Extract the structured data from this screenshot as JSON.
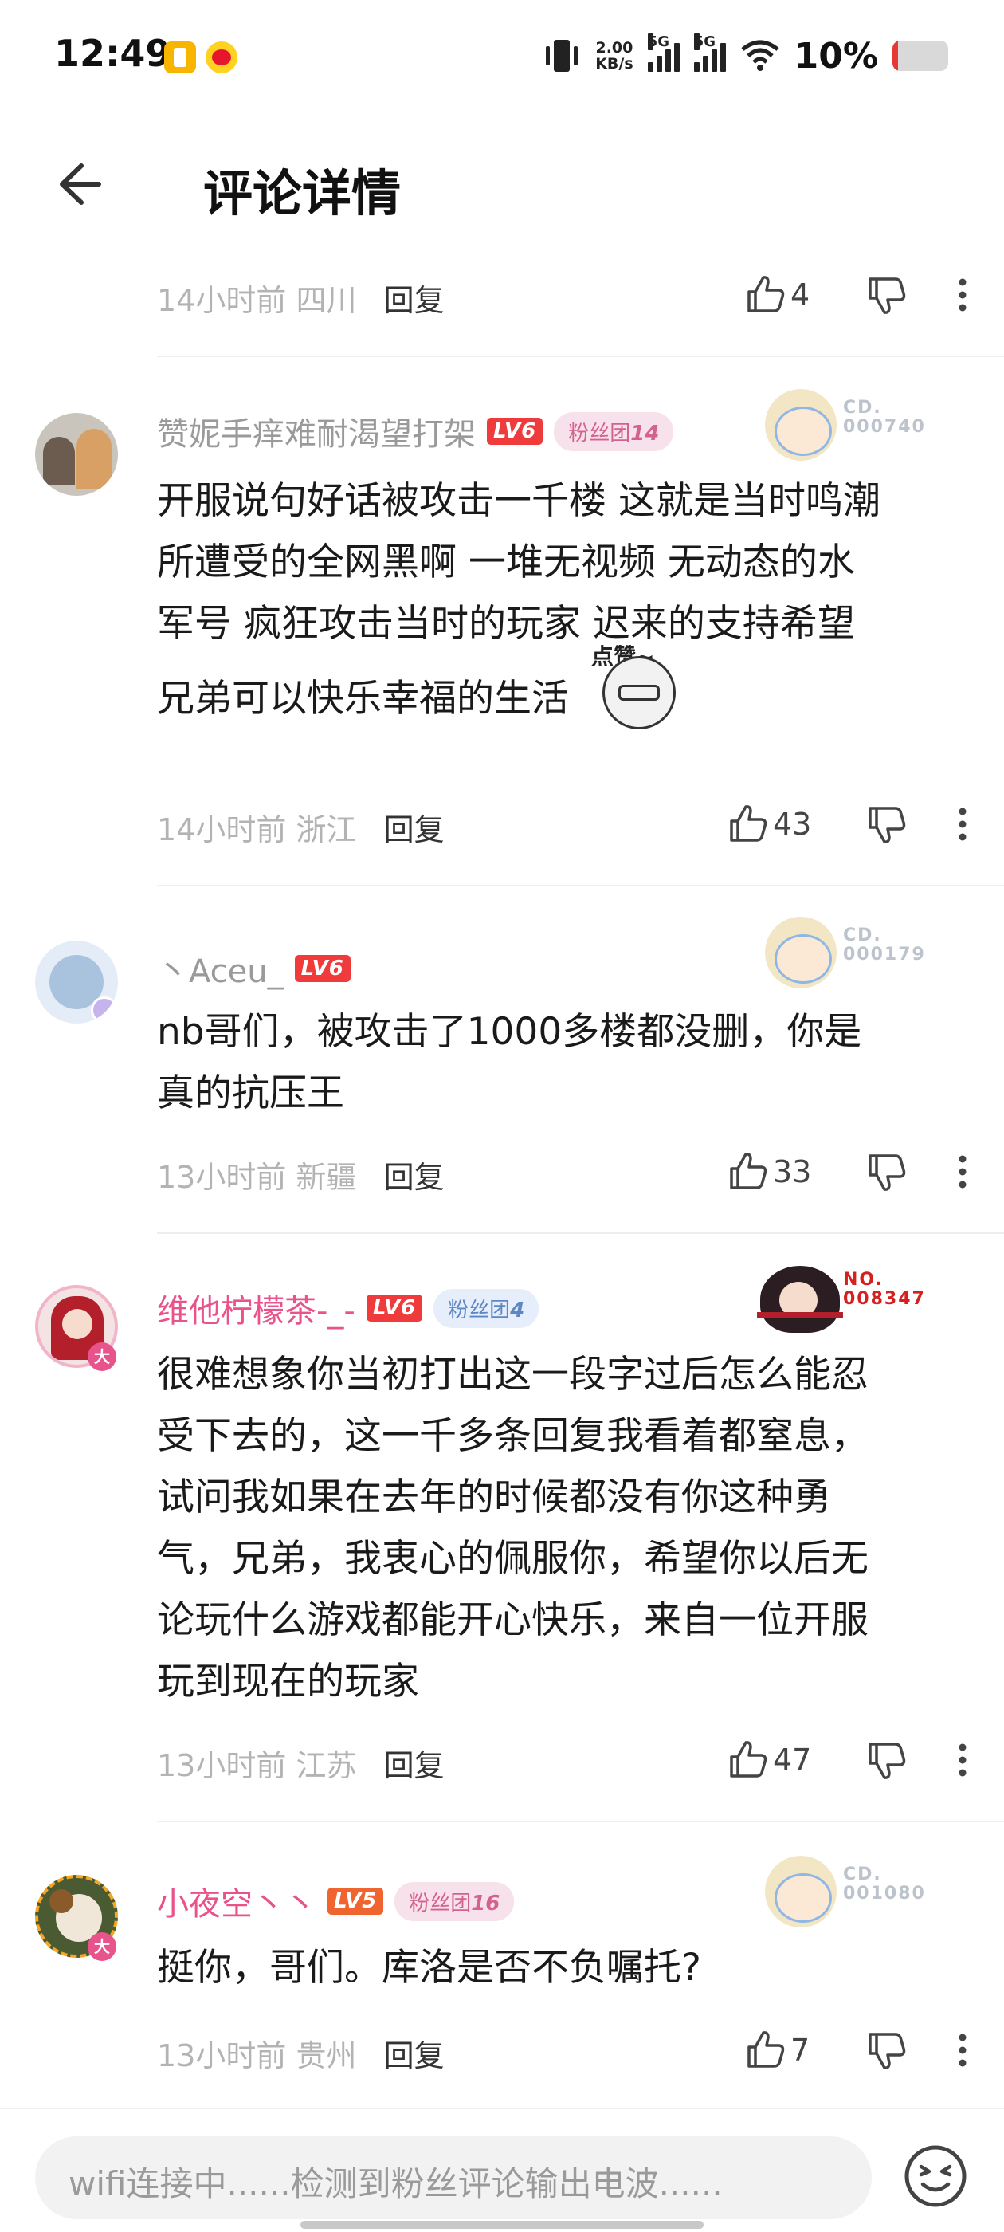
{
  "status_bar": {
    "time": "12:49",
    "speed_value": "2.00",
    "speed_unit": "KB/s",
    "sim1": "5G",
    "sim2": "5G",
    "battery": "10%"
  },
  "header": {
    "title": "评论详情"
  },
  "top_meta": {
    "time": "14小时前",
    "location": "四川",
    "reply": "回复",
    "likes": "4"
  },
  "comments": [
    {
      "username": "赞妮手痒难耐渴望打架",
      "level": "LV6",
      "fans_label": "粉丝团",
      "fans_level": "14",
      "badge_no": "CD.",
      "badge_num": "000740",
      "text_lines": [
        "开服说句好话被攻击一千楼 这就是当时鸣潮",
        "所遭受的全网黑啊 一堆无视频 无动态的水",
        "军号 疯狂攻击当时的玩家 迟来的支持希望",
        "兄弟可以快乐幸福的生活"
      ],
      "sticker_text": "点赞~",
      "time": "14小时前",
      "location": "浙江",
      "reply": "回复",
      "likes": "43"
    },
    {
      "username": "丶Aceu_",
      "level": "LV6",
      "badge_no": "CD.",
      "badge_num": "000179",
      "text_lines": [
        "nb哥们，被攻击了1000多楼都没删，你是",
        "真的抗压王"
      ],
      "time": "13小时前",
      "location": "新疆",
      "reply": "回复",
      "likes": "33"
    },
    {
      "username": "维他柠檬茶-_-",
      "level": "LV6",
      "fans_label": "粉丝团",
      "fans_level": "4",
      "badge_no": "NO.",
      "badge_num": "008347",
      "avatar_tag": "大",
      "text_lines": [
        "很难想象你当初打出这一段字过后怎么能忍",
        "受下去的，这一千多条回复我看着都窒息，",
        "试问我如果在去年的时候都没有你这种勇",
        "气，兄弟，我衷心的佩服你，希望你以后无",
        "论玩什么游戏都能开心快乐，来自一位开服",
        "玩到现在的玩家"
      ],
      "time": "13小时前",
      "location": "江苏",
      "reply": "回复",
      "likes": "47"
    },
    {
      "username": "小夜空丶丶",
      "level": "LV5",
      "fans_label": "粉丝团",
      "fans_level": "16",
      "badge_no": "CD.",
      "badge_num": "001080",
      "avatar_tag": "大",
      "text_lines": [
        "挺你，哥们。库洛是否不负嘱托?"
      ],
      "time": "13小时前",
      "location": "贵州",
      "reply": "回复",
      "likes": "7"
    }
  ],
  "input": {
    "placeholder": "wifi连接中......检测到粉丝评论输出电波......"
  },
  "icons": [
    "back-arrow-icon",
    "thumbs-up-icon",
    "thumbs-down-icon",
    "more-vertical-icon",
    "emoji-icon",
    "wifi-icon",
    "vibrate-icon",
    "signal-icon",
    "battery-icon"
  ],
  "colors": {
    "vip_name": "#e9538b",
    "level_badge": "#ef3b3b",
    "fans_badge_pink": "#f7e1ea",
    "fans_badge_blue": "#e6eefb",
    "battery_low": "#e53935"
  }
}
